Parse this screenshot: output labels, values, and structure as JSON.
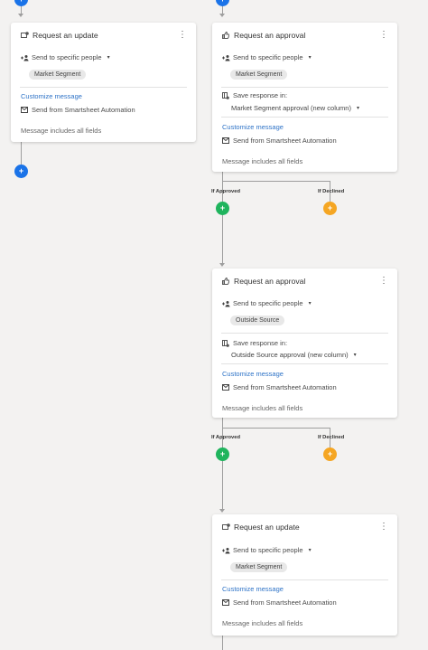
{
  "colors": {
    "blue": "#1a73e8",
    "green": "#1fb45d",
    "orange": "#f5a623",
    "link": "#2e73c7"
  },
  "add_symbol": "+",
  "kebab_symbol": "⋮",
  "caret_symbol": "▾",
  "branch": {
    "approved": "If Approved",
    "declined": "If Declined"
  },
  "cards": [
    {
      "title": "Request an update",
      "icon": "update-request-icon",
      "send_to": "Send to specific people",
      "chip": "Market Segment",
      "customize": "Customize message",
      "send_from": "Send from Smartsheet Automation",
      "note": "Message includes all fields"
    },
    {
      "title": "Request an approval",
      "icon": "thumbs-up-icon",
      "send_to": "Send to specific people",
      "chip": "Market Segment",
      "save_label": "Save response in:",
      "save_value": "Market Segment approval (new column)",
      "customize": "Customize message",
      "send_from": "Send from Smartsheet Automation",
      "note": "Message includes all fields"
    },
    {
      "title": "Request an approval",
      "icon": "thumbs-up-icon",
      "send_to": "Send to specific people",
      "chip": "Outside Source",
      "save_label": "Save response in:",
      "save_value": "Outside Source approval (new column)",
      "customize": "Customize message",
      "send_from": "Send from Smartsheet Automation",
      "note": "Message includes all fields"
    },
    {
      "title": "Request an update",
      "icon": "update-request-icon",
      "send_to": "Send to specific people",
      "chip": "Market Segment",
      "customize": "Customize message",
      "send_from": "Send from Smartsheet Automation",
      "note": "Message includes all fields"
    }
  ]
}
